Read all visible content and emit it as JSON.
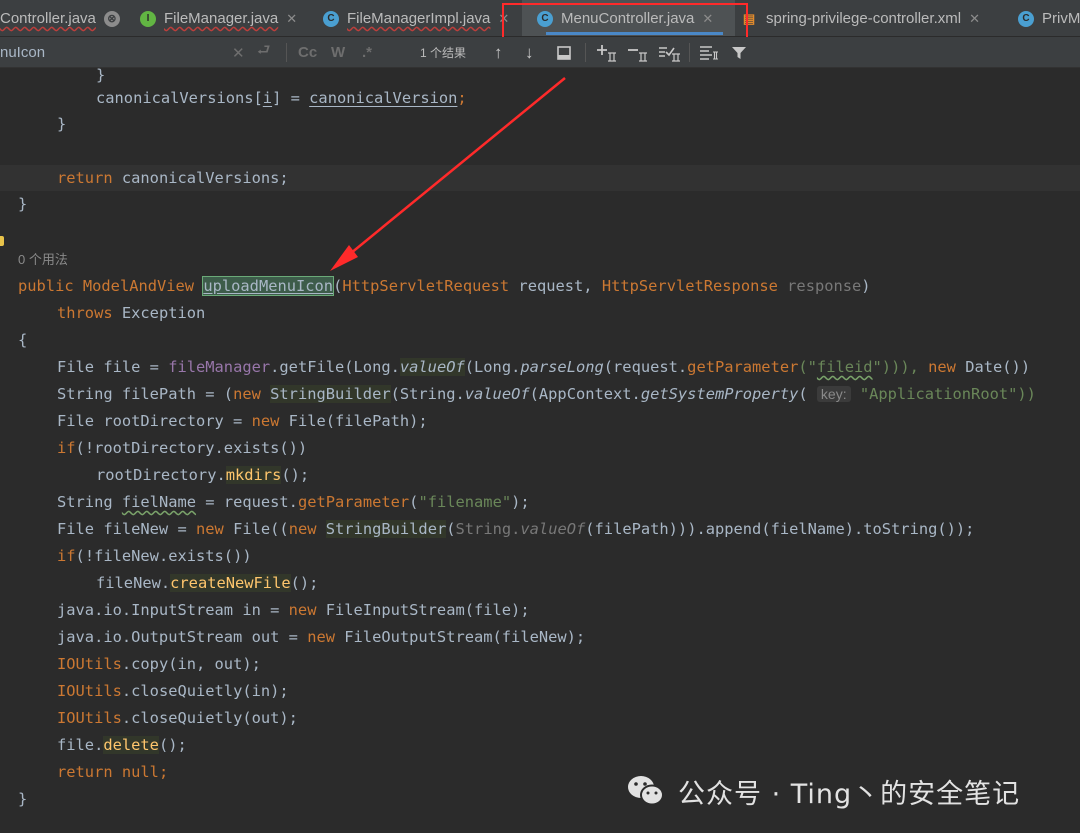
{
  "tabs": [
    {
      "label": "Controller.java",
      "icon": "class-icon-c",
      "close": "⊗"
    },
    {
      "label": "FileManager.java",
      "icon": "interface-icon-i",
      "close": "✕"
    },
    {
      "label": "FileManagerImpl.java",
      "icon": "class-icon-c",
      "close": "✕"
    },
    {
      "label": "MenuController.java",
      "icon": "class-icon-c",
      "close": "✕",
      "active": true
    },
    {
      "label": "spring-privilege-controller.xml",
      "icon": "xml-file-icon",
      "close": "✕"
    },
    {
      "label": "PrivM",
      "icon": "class-icon-c"
    }
  ],
  "icon_letters": {
    "class": "C",
    "interface": "I"
  },
  "find": {
    "query": "nuIcon",
    "clear": "✕",
    "regex_history": "⮐",
    "match_case": "Cc",
    "words": "W",
    "regex": ".*",
    "result_count": "1 个结果",
    "prev": "↑",
    "next": "↓"
  },
  "editor": {
    "lines": {
      "l0": "}",
      "l1a": "canonicalVersions[",
      "l1b": "i",
      "l1c": "] = ",
      "l1d": "canonicalVersion",
      "l1e": ";",
      "l2": "}",
      "l4a": "return",
      "l4b": " canonicalVersions;",
      "l5": "}",
      "usage": "0 个用法",
      "l7a": "public ",
      "l7b": "ModelAndView ",
      "l7c": "uploadMenuIcon",
      "l7d": "(",
      "l7e": "HttpServletRequest",
      "l7f": " request, ",
      "l7g": "HttpServletResponse",
      "l7h": " response",
      "l7i": ")",
      "l8a": "throws ",
      "l8b": "Exception",
      "l9": "{",
      "l10a": "File file = ",
      "l10b": "fileManager",
      "l10c": ".getFile(Long.",
      "l10d": "valueOf",
      "l10e": "(Long.",
      "l10f": "parseLong",
      "l10g": "(request.",
      "l10h": "getParameter",
      "l10i": "(\"",
      "l10j": "fileid",
      "l10k": "\"))), ",
      "l10l": "new",
      "l10m": " Date())",
      "l11a": "String filePath = (",
      "l11b": "new ",
      "l11c": "StringBuilder",
      "l11d": "(String.",
      "l11e": "valueOf",
      "l11f": "(AppContext.",
      "l11g": "getSystemProperty",
      "l11h": "( ",
      "l11hint": "key:",
      "l11i": " \"ApplicationRoot\"))",
      "l12a": "File rootDirectory = ",
      "l12b": "new",
      "l12c": " File(filePath);",
      "l13a": "if",
      "l13b": "(!rootDirectory.exists())",
      "l14a": "rootDirectory.",
      "l14b": "mkdirs",
      "l14c": "();",
      "l15a": "String ",
      "l15b": "fielName",
      "l15c": " = request.",
      "l15d": "getParameter",
      "l15e": "(",
      "l15f": "\"filename\"",
      "l15g": ");",
      "l16a": "File fileNew = ",
      "l16b": "new",
      "l16c": " File((",
      "l16d": "new ",
      "l16e": "StringBuilder",
      "l16f": "(",
      "l16g": "String.",
      "l16h": "valueOf",
      "l16i": "(filePath))).append(fielName).toString());",
      "l17a": "if",
      "l17b": "(!fileNew.exists())",
      "l18a": "fileNew.",
      "l18b": "createNewFile",
      "l18c": "();",
      "l19a": "java.io.InputStream in = ",
      "l19b": "new",
      "l19c": " FileInputStream(file);",
      "l20a": "java.io.OutputStream out = ",
      "l20b": "new",
      "l20c": " FileOutputStream(fileNew);",
      "l21a": "IOUtils",
      "l21b": ".copy(in, out);",
      "l22a": "IOUtils",
      "l22b": ".closeQuietly(in);",
      "l23a": "IOUtils",
      "l23b": ".closeQuietly(out);",
      "l24a": "file.",
      "l24b": "delete",
      "l24c": "();",
      "l25a": "return null",
      "l25b": ";",
      "l26": "}"
    }
  },
  "watermark": {
    "text": "公众号 · Ting丶的安全笔记"
  },
  "colors": {
    "annotation": "#ff2a2a",
    "keyword": "#cc7832",
    "method": "#ffc66d",
    "field": "#9876aa",
    "string": "#6a8759",
    "background": "#2b2b2b"
  }
}
